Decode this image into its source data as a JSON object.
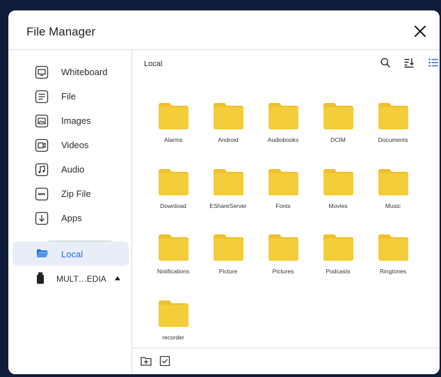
{
  "window": {
    "title": "File Manager"
  },
  "sidebar": {
    "items": [
      {
        "label": "Whiteboard",
        "icon": "whiteboard-icon"
      },
      {
        "label": "File",
        "icon": "file-icon"
      },
      {
        "label": "Images",
        "icon": "image-icon"
      },
      {
        "label": "Videos",
        "icon": "video-icon"
      },
      {
        "label": "Audio",
        "icon": "music-icon"
      },
      {
        "label": "Zip File",
        "icon": "zip-icon"
      },
      {
        "label": "Apps",
        "icon": "download-icon"
      }
    ],
    "local": {
      "label": "Local",
      "icon": "folder-open-icon"
    },
    "usb": {
      "label": "MULT…EDIA",
      "icon": "usb-drive-icon"
    }
  },
  "main": {
    "path": "Local",
    "folders": [
      "Alarms",
      "Android",
      "Audiobooks",
      "DCIM",
      "Documents",
      "Download",
      "EShareServer",
      "Fonts",
      "Movies",
      "Music",
      "Notifications",
      "Picture",
      "Pictures",
      "Podcasts",
      "Ringtones",
      "recorder"
    ]
  },
  "colors": {
    "accent": "#1e6fd9",
    "folder": "#f4cd3a",
    "selected_bg": "#e8eef8"
  }
}
